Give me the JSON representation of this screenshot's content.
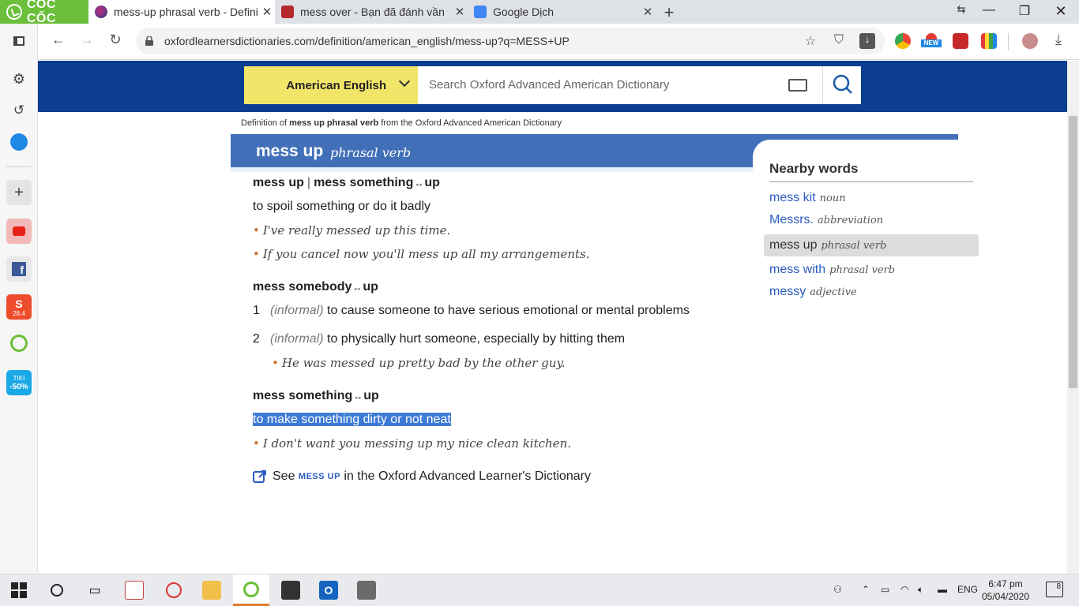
{
  "browser": {
    "brand": "CỐC CỐC",
    "tabs": [
      {
        "title": "mess-up phrasal verb - Defini",
        "active": true
      },
      {
        "title": "mess over - Bạn đã đánh vần",
        "active": false
      },
      {
        "title": "Google Dịch",
        "active": false
      }
    ],
    "url": "oxfordlearnersdictionaries.com/definition/american_english/mess-up?q=MESS+UP",
    "ext_badge": "NEW"
  },
  "site": {
    "language": "American English",
    "search_placeholder": "Search Oxford Advanced American Dictionary"
  },
  "entry": {
    "source_prefix": "Definition of ",
    "source_bold": "mess up phrasal verb",
    "source_suffix": " from the Oxford Advanced American Dictionary",
    "headword": "mess up",
    "pos": "phrasal verb",
    "s1": {
      "phrase_a": "mess up",
      "sep": "|",
      "phrase_b": "mess something",
      "arrow": "↔",
      "phrase_b_end": "up",
      "def": "to spoil something or do it badly",
      "examples": [
        "I've really messed up this time.",
        "If you cancel now you'll mess up all my arrangements."
      ]
    },
    "s2": {
      "phrase": "mess somebody",
      "arrow": "↔",
      "phrase_end": "up",
      "senses": [
        {
          "num": "1",
          "label_open": "(",
          "label": "informal",
          "label_close": ")",
          "def": "to cause someone to have serious emotional or mental problems"
        },
        {
          "num": "2",
          "label_open": "(",
          "label": "informal",
          "label_close": ")",
          "def": "to physically hurt someone, especially by hitting them",
          "example": "He was messed up pretty bad by the other guy."
        }
      ]
    },
    "s3": {
      "phrase": "mess something",
      "arrow": "↔",
      "phrase_end": "up",
      "def": "to make something dirty or not neat",
      "example": "I don't want you messing up my nice clean kitchen."
    },
    "see": {
      "prefix": "See ",
      "word": "MESS UP",
      "suffix": " in the Oxford Advanced Learner's Dictionary"
    }
  },
  "nearby": {
    "title": "Nearby words",
    "items": [
      {
        "word": "mess kit",
        "pos": "noun"
      },
      {
        "word": "Messrs.",
        "pos": "abbreviation"
      },
      {
        "word": "mess up",
        "pos": "phrasal verb",
        "current": true
      },
      {
        "word": "mess with",
        "pos": "phrasal verb"
      },
      {
        "word": "messy",
        "pos": "adjective"
      }
    ]
  },
  "taskbar": {
    "lang": "ENG",
    "time": "6:47 pm",
    "date": "05/04/2020",
    "notif_count": "8",
    "tiki_top": "TIKI",
    "tiki_bottom": "-50%",
    "shopee_badge": "28.4"
  },
  "colors": {
    "brand": "#6bbf3a",
    "banner": "#0b3d91",
    "headbar": "#4270b8",
    "lang": "#f2e66a",
    "link": "#2a5bbf",
    "highlight": "#3e7bd6"
  }
}
